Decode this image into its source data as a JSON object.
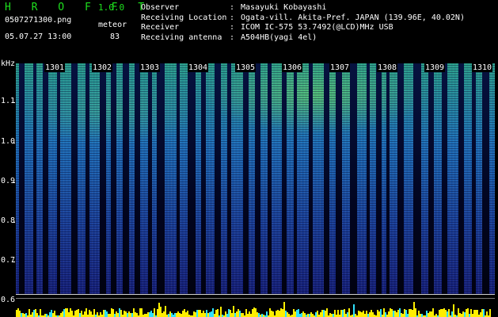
{
  "header": {
    "app_title": "H R O F F T",
    "app_version": "1.0.0",
    "file_name": "0507271300.png",
    "mode": "meteor",
    "date_time": "05.07.27 13:00",
    "count": "83"
  },
  "info": {
    "observer_label": "Observer",
    "observer_value": "Masayuki Kobayashi",
    "location_label": "Receiving Location",
    "location_value": "Ogata-vill. Akita-Pref. JAPAN (139.96E, 40.02N)",
    "receiver_label": "Receiver",
    "receiver_value": "ICOM IC-575 53.7492(@LCD)MHz USB",
    "antenna_label": "Receiving antenna",
    "antenna_value": "A504HB(yagi 4el)",
    "separator": ":"
  },
  "spectrogram": {
    "frequency_unit": "kHz",
    "frequency_labels": [
      "1.1",
      "1.0",
      "0.9",
      "0.8",
      "0.7",
      "0.6"
    ],
    "time_labels": [
      "1301",
      "1302",
      "1303",
      "1304",
      "1305",
      "1306",
      "1307",
      "1308",
      "1309",
      "1310"
    ]
  },
  "colors": {
    "title_green": "#1ee01e",
    "signal_high": "#78e65a",
    "signal_low": "#16207a",
    "meter_yellow": "#ffee00",
    "meter_cyan": "#2fe0ff"
  }
}
